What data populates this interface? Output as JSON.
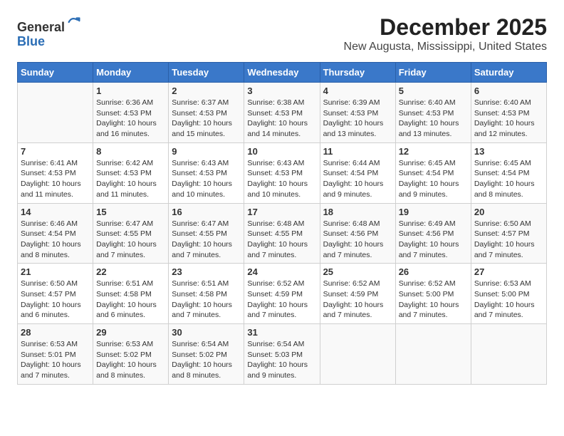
{
  "logo": {
    "general": "General",
    "blue": "Blue"
  },
  "title": "December 2025",
  "subtitle": "New Augusta, Mississippi, United States",
  "days_header": [
    "Sunday",
    "Monday",
    "Tuesday",
    "Wednesday",
    "Thursday",
    "Friday",
    "Saturday"
  ],
  "weeks": [
    [
      {
        "day": "",
        "info": ""
      },
      {
        "day": "1",
        "info": "Sunrise: 6:36 AM\nSunset: 4:53 PM\nDaylight: 10 hours\nand 16 minutes."
      },
      {
        "day": "2",
        "info": "Sunrise: 6:37 AM\nSunset: 4:53 PM\nDaylight: 10 hours\nand 15 minutes."
      },
      {
        "day": "3",
        "info": "Sunrise: 6:38 AM\nSunset: 4:53 PM\nDaylight: 10 hours\nand 14 minutes."
      },
      {
        "day": "4",
        "info": "Sunrise: 6:39 AM\nSunset: 4:53 PM\nDaylight: 10 hours\nand 13 minutes."
      },
      {
        "day": "5",
        "info": "Sunrise: 6:40 AM\nSunset: 4:53 PM\nDaylight: 10 hours\nand 13 minutes."
      },
      {
        "day": "6",
        "info": "Sunrise: 6:40 AM\nSunset: 4:53 PM\nDaylight: 10 hours\nand 12 minutes."
      }
    ],
    [
      {
        "day": "7",
        "info": "Sunrise: 6:41 AM\nSunset: 4:53 PM\nDaylight: 10 hours\nand 11 minutes."
      },
      {
        "day": "8",
        "info": "Sunrise: 6:42 AM\nSunset: 4:53 PM\nDaylight: 10 hours\nand 11 minutes."
      },
      {
        "day": "9",
        "info": "Sunrise: 6:43 AM\nSunset: 4:53 PM\nDaylight: 10 hours\nand 10 minutes."
      },
      {
        "day": "10",
        "info": "Sunrise: 6:43 AM\nSunset: 4:53 PM\nDaylight: 10 hours\nand 10 minutes."
      },
      {
        "day": "11",
        "info": "Sunrise: 6:44 AM\nSunset: 4:54 PM\nDaylight: 10 hours\nand 9 minutes."
      },
      {
        "day": "12",
        "info": "Sunrise: 6:45 AM\nSunset: 4:54 PM\nDaylight: 10 hours\nand 9 minutes."
      },
      {
        "day": "13",
        "info": "Sunrise: 6:45 AM\nSunset: 4:54 PM\nDaylight: 10 hours\nand 8 minutes."
      }
    ],
    [
      {
        "day": "14",
        "info": "Sunrise: 6:46 AM\nSunset: 4:54 PM\nDaylight: 10 hours\nand 8 minutes."
      },
      {
        "day": "15",
        "info": "Sunrise: 6:47 AM\nSunset: 4:55 PM\nDaylight: 10 hours\nand 7 minutes."
      },
      {
        "day": "16",
        "info": "Sunrise: 6:47 AM\nSunset: 4:55 PM\nDaylight: 10 hours\nand 7 minutes."
      },
      {
        "day": "17",
        "info": "Sunrise: 6:48 AM\nSunset: 4:55 PM\nDaylight: 10 hours\nand 7 minutes."
      },
      {
        "day": "18",
        "info": "Sunrise: 6:48 AM\nSunset: 4:56 PM\nDaylight: 10 hours\nand 7 minutes."
      },
      {
        "day": "19",
        "info": "Sunrise: 6:49 AM\nSunset: 4:56 PM\nDaylight: 10 hours\nand 7 minutes."
      },
      {
        "day": "20",
        "info": "Sunrise: 6:50 AM\nSunset: 4:57 PM\nDaylight: 10 hours\nand 7 minutes."
      }
    ],
    [
      {
        "day": "21",
        "info": "Sunrise: 6:50 AM\nSunset: 4:57 PM\nDaylight: 10 hours\nand 6 minutes."
      },
      {
        "day": "22",
        "info": "Sunrise: 6:51 AM\nSunset: 4:58 PM\nDaylight: 10 hours\nand 6 minutes."
      },
      {
        "day": "23",
        "info": "Sunrise: 6:51 AM\nSunset: 4:58 PM\nDaylight: 10 hours\nand 7 minutes."
      },
      {
        "day": "24",
        "info": "Sunrise: 6:52 AM\nSunset: 4:59 PM\nDaylight: 10 hours\nand 7 minutes."
      },
      {
        "day": "25",
        "info": "Sunrise: 6:52 AM\nSunset: 4:59 PM\nDaylight: 10 hours\nand 7 minutes."
      },
      {
        "day": "26",
        "info": "Sunrise: 6:52 AM\nSunset: 5:00 PM\nDaylight: 10 hours\nand 7 minutes."
      },
      {
        "day": "27",
        "info": "Sunrise: 6:53 AM\nSunset: 5:00 PM\nDaylight: 10 hours\nand 7 minutes."
      }
    ],
    [
      {
        "day": "28",
        "info": "Sunrise: 6:53 AM\nSunset: 5:01 PM\nDaylight: 10 hours\nand 7 minutes."
      },
      {
        "day": "29",
        "info": "Sunrise: 6:53 AM\nSunset: 5:02 PM\nDaylight: 10 hours\nand 8 minutes."
      },
      {
        "day": "30",
        "info": "Sunrise: 6:54 AM\nSunset: 5:02 PM\nDaylight: 10 hours\nand 8 minutes."
      },
      {
        "day": "31",
        "info": "Sunrise: 6:54 AM\nSunset: 5:03 PM\nDaylight: 10 hours\nand 9 minutes."
      },
      {
        "day": "",
        "info": ""
      },
      {
        "day": "",
        "info": ""
      },
      {
        "day": "",
        "info": ""
      }
    ]
  ]
}
